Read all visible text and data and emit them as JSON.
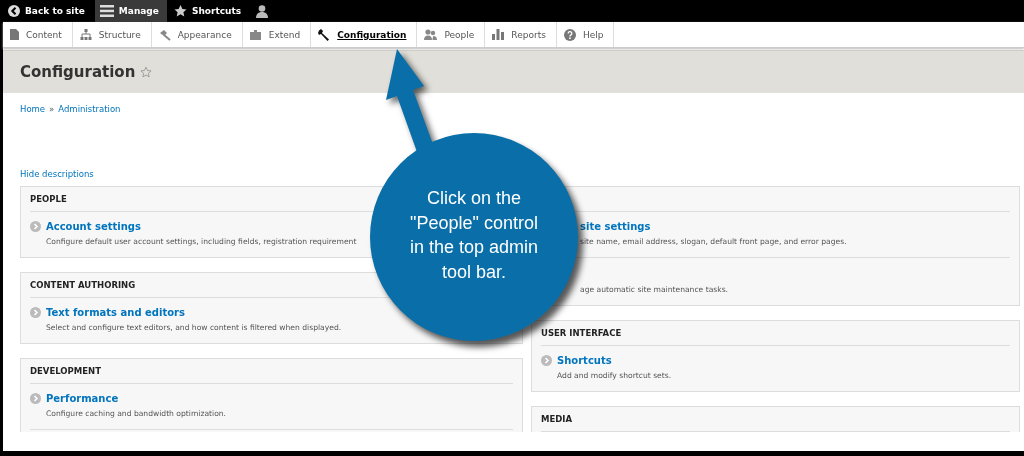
{
  "toolbar": {
    "items": [
      {
        "label": "Back to site",
        "selected": false
      },
      {
        "label": "Manage",
        "selected": true
      },
      {
        "label": "Shortcuts",
        "selected": false
      },
      {
        "selected": false
      }
    ]
  },
  "tabs": [
    {
      "label": "Content",
      "selected": false
    },
    {
      "label": "Structure",
      "selected": false
    },
    {
      "label": "Appearance",
      "selected": false
    },
    {
      "label": "Extend",
      "selected": false
    },
    {
      "label": "Configuration",
      "selected": true
    },
    {
      "label": "People",
      "selected": false
    },
    {
      "label": "Reports",
      "selected": false
    },
    {
      "label": "Help",
      "selected": false
    }
  ],
  "page": {
    "title": "Configuration",
    "breadcrumb": {
      "items": [
        "Home",
        "Administration"
      ],
      "separator": "»"
    },
    "toggle": "Hide descriptions"
  },
  "columns": [
    [
      {
        "title": "PEOPLE",
        "items": [
          {
            "title": "Account settings",
            "description": "Configure default user account settings, including fields, registration requirement",
            "covered": false
          }
        ],
        "cut": false
      },
      {
        "title": "CONTENT AUTHORING",
        "items": [
          {
            "title": "Text formats and editors",
            "description": "Select and configure text editors, and how content is filtered when displayed.",
            "covered": false
          }
        ],
        "cut": false
      },
      {
        "title": "DEVELOPMENT",
        "items": [
          {
            "title": "Performance",
            "description": "Configure caching and bandwidth optimization.",
            "covered": false
          }
        ],
        "cut": true
      }
    ],
    [
      {
        "items": [
          {
            "title": "site settings",
            "description": "site name, email address, slogan, default front page, and error pages.",
            "covered": true
          },
          {
            "description": "age automatic site maintenance tasks.",
            "covered": true
          }
        ],
        "cut": false
      },
      {
        "title": "USER INTERFACE",
        "items": [
          {
            "title": "Shortcuts",
            "description": "Add and modify shortcut sets.",
            "covered": false
          }
        ],
        "cut": false
      },
      {
        "title": "MEDIA",
        "cut": true
      }
    ]
  ],
  "callout": {
    "lines": [
      "Click on the",
      "\"People\" control",
      "in the top admin",
      "tool bar."
    ]
  }
}
